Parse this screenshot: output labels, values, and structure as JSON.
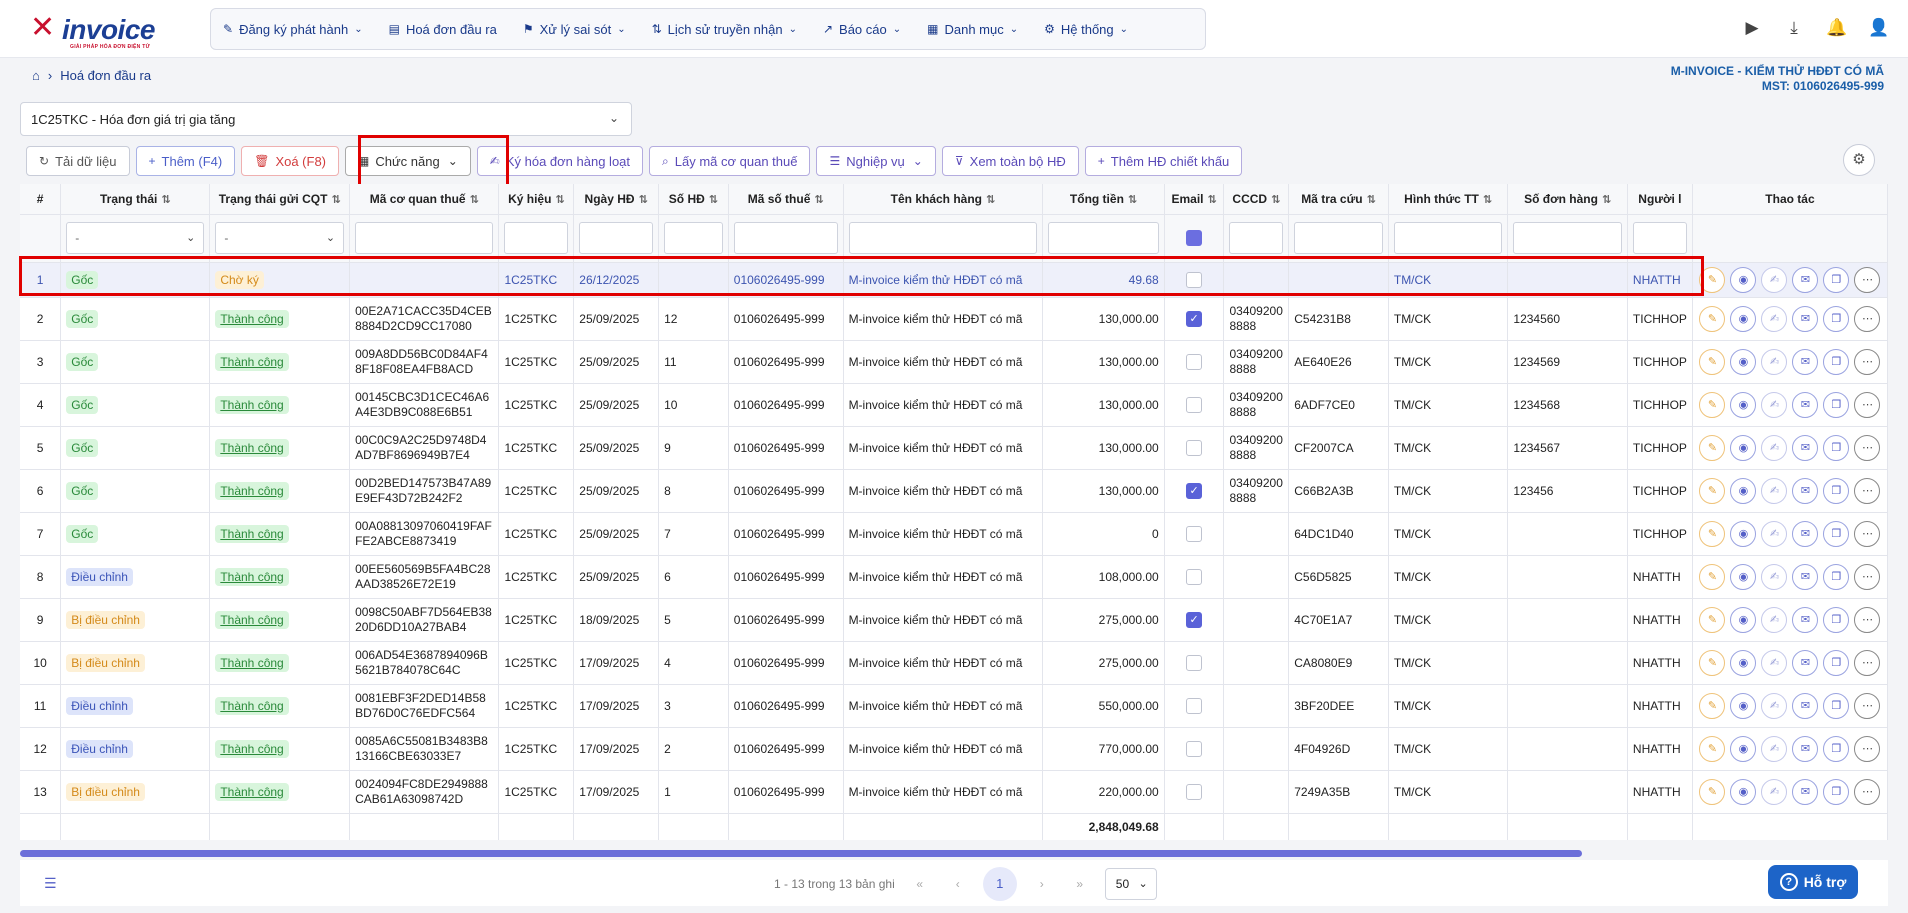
{
  "app": {
    "logo_text": "invoice",
    "logo_tagline": "GIẢI PHÁP HÓA ĐƠN ĐIỆN TỬ"
  },
  "menu": [
    {
      "label": "Đăng ký phát hành",
      "icon": "register-icon",
      "chevron": true
    },
    {
      "label": "Hoá đơn đầu ra",
      "icon": "document-icon",
      "chevron": false
    },
    {
      "label": "Xử lý sai sót",
      "icon": "error-file-icon",
      "chevron": true
    },
    {
      "label": "Lịch sử truyền nhận",
      "icon": "transfer-icon",
      "chevron": true
    },
    {
      "label": "Báo cáo",
      "icon": "report-chart-icon",
      "chevron": true
    },
    {
      "label": "Danh mục",
      "icon": "grid-icon",
      "chevron": true
    },
    {
      "label": "Hệ thống",
      "icon": "gear-icon",
      "chevron": true
    }
  ],
  "breadcrumb": {
    "current": "Hoá đơn đầu ra"
  },
  "company": {
    "name": "M-INVOICE - KIỂM THỬ HĐĐT CÓ MÃ",
    "tax_code": "MST: 0106026495-999"
  },
  "doc_type_select": {
    "value": "1C25TKC - Hóa đơn giá trị gia tăng"
  },
  "toolbar": {
    "reload": "Tải dữ liệu",
    "add": "Thêm (F4)",
    "delete": "Xoá (F8)",
    "functions": "Chức năng",
    "bulk_sign": "Ký hóa đơn hàng loạt",
    "get_tax_code": "Lấy mã cơ quan thuế",
    "operations": "Nghiệp vụ",
    "view_all": "Xem toàn bộ HĐ",
    "add_discount": "Thêm HĐ chiết khấu"
  },
  "columns": [
    "#",
    "Trạng thái",
    "Trạng thái gửi CQT",
    "Mã cơ quan thuế",
    "Ký hiệu",
    "Ngày HĐ",
    "Số HĐ",
    "Mã số thuế",
    "Tên khách hàng",
    "Tổng tiền",
    "Email",
    "CCCD",
    "Mã tra cứu",
    "Hình thức TT",
    "Số đơn hàng",
    "Người l",
    "Thao tác"
  ],
  "filters": {
    "status": "-",
    "cqt_status": "-"
  },
  "rows": [
    {
      "no": "1",
      "status": "Gốc",
      "status_type": "goc",
      "cqt": "Chờ ký",
      "cqt_type": "ck",
      "tax_auth_code": "",
      "symbol": "1C25TKC",
      "date": "26/12/2025",
      "inv_no": "",
      "tax_id": "0106026495-999",
      "customer": "M-invoice kiểm thử HĐĐT có mã",
      "total": "49.68",
      "email": false,
      "cccd": "",
      "lookup": "",
      "payment": "TM/CK",
      "order_no": "",
      "creator": "NHATTH"
    },
    {
      "no": "2",
      "status": "Gốc",
      "status_type": "goc",
      "cqt": "Thành công",
      "cqt_type": "tc",
      "tax_auth_code": "00E2A71CACC35D4CEB8884D2CD9CC17080",
      "symbol": "1C25TKC",
      "date": "25/09/2025",
      "inv_no": "12",
      "tax_id": "0106026495-999",
      "customer": "M-invoice kiểm thử HĐĐT có mã",
      "total": "130,000.00",
      "email": true,
      "cccd": "034092008888",
      "lookup": "C54231B8",
      "payment": "TM/CK",
      "order_no": "1234560",
      "creator": "TICHHOP"
    },
    {
      "no": "3",
      "status": "Gốc",
      "status_type": "goc",
      "cqt": "Thành công",
      "cqt_type": "tc",
      "tax_auth_code": "009A8DD56BC0D84AF48F18F08EA4FB8ACD",
      "symbol": "1C25TKC",
      "date": "25/09/2025",
      "inv_no": "11",
      "tax_id": "0106026495-999",
      "customer": "M-invoice kiểm thử HĐĐT có mã",
      "total": "130,000.00",
      "email": false,
      "cccd": "034092008888",
      "lookup": "AE640E26",
      "payment": "TM/CK",
      "order_no": "1234569",
      "creator": "TICHHOP"
    },
    {
      "no": "4",
      "status": "Gốc",
      "status_type": "goc",
      "cqt": "Thành công",
      "cqt_type": "tc",
      "tax_auth_code": "00145CBC3D1CEC46A6A4E3DB9C088E6B51",
      "symbol": "1C25TKC",
      "date": "25/09/2025",
      "inv_no": "10",
      "tax_id": "0106026495-999",
      "customer": "M-invoice kiểm thử HĐĐT có mã",
      "total": "130,000.00",
      "email": false,
      "cccd": "034092008888",
      "lookup": "6ADF7CE0",
      "payment": "TM/CK",
      "order_no": "1234568",
      "creator": "TICHHOP"
    },
    {
      "no": "5",
      "status": "Gốc",
      "status_type": "goc",
      "cqt": "Thành công",
      "cqt_type": "tc",
      "tax_auth_code": "00C0C9A2C25D9748D4AD7BF8696949B7E4",
      "symbol": "1C25TKC",
      "date": "25/09/2025",
      "inv_no": "9",
      "tax_id": "0106026495-999",
      "customer": "M-invoice kiểm thử HĐĐT có mã",
      "total": "130,000.00",
      "email": false,
      "cccd": "034092008888",
      "lookup": "CF2007CA",
      "payment": "TM/CK",
      "order_no": "1234567",
      "creator": "TICHHOP"
    },
    {
      "no": "6",
      "status": "Gốc",
      "status_type": "goc",
      "cqt": "Thành công",
      "cqt_type": "tc",
      "tax_auth_code": "00D2BED147573B47A89E9EF43D72B242F2",
      "symbol": "1C25TKC",
      "date": "25/09/2025",
      "inv_no": "8",
      "tax_id": "0106026495-999",
      "customer": "M-invoice kiểm thử HĐĐT có mã",
      "total": "130,000.00",
      "email": true,
      "cccd": "034092008888",
      "lookup": "C66B2A3B",
      "payment": "TM/CK",
      "order_no": "123456",
      "creator": "TICHHOP"
    },
    {
      "no": "7",
      "status": "Gốc",
      "status_type": "goc",
      "cqt": "Thành công",
      "cqt_type": "tc",
      "tax_auth_code": "00A08813097060419FAFFE2ABCE8873419",
      "symbol": "1C25TKC",
      "date": "25/09/2025",
      "inv_no": "7",
      "tax_id": "0106026495-999",
      "customer": "M-invoice kiểm thử HĐĐT có mã",
      "total": "0",
      "email": false,
      "cccd": "",
      "lookup": "64DC1D40",
      "payment": "TM/CK",
      "order_no": "",
      "creator": "TICHHOP"
    },
    {
      "no": "8",
      "status": "Điều chỉnh",
      "status_type": "dc",
      "cqt": "Thành công",
      "cqt_type": "tc",
      "tax_auth_code": "00EE560569B5FA4BC28AAD38526E72E19",
      "symbol": "1C25TKC",
      "date": "25/09/2025",
      "inv_no": "6",
      "tax_id": "0106026495-999",
      "customer": "M-invoice kiểm thử HĐĐT có mã",
      "total": "108,000.00",
      "email": false,
      "cccd": "",
      "lookup": "C56D5825",
      "payment": "TM/CK",
      "order_no": "",
      "creator": "NHATTH"
    },
    {
      "no": "9",
      "status": "Bị điều chỉnh",
      "status_type": "bdc",
      "cqt": "Thành công",
      "cqt_type": "tc",
      "tax_auth_code": "0098C50ABF7D564EB3820D6DD10A27BAB4",
      "symbol": "1C25TKC",
      "date": "18/09/2025",
      "inv_no": "5",
      "tax_id": "0106026495-999",
      "customer": "M-invoice kiểm thử HĐĐT có mã",
      "total": "275,000.00",
      "email": true,
      "cccd": "",
      "lookup": "4C70E1A7",
      "payment": "TM/CK",
      "order_no": "",
      "creator": "NHATTH"
    },
    {
      "no": "10",
      "status": "Bị điều chỉnh",
      "status_type": "bdc",
      "cqt": "Thành công",
      "cqt_type": "tc",
      "tax_auth_code": "006AD54E3687894096B5621B784078C64C",
      "symbol": "1C25TKC",
      "date": "17/09/2025",
      "inv_no": "4",
      "tax_id": "0106026495-999",
      "customer": "M-invoice kiểm thử HĐĐT có mã",
      "total": "275,000.00",
      "email": false,
      "cccd": "",
      "lookup": "CA8080E9",
      "payment": "TM/CK",
      "order_no": "",
      "creator": "NHATTH"
    },
    {
      "no": "11",
      "status": "Điều chỉnh",
      "status_type": "dc",
      "cqt": "Thành công",
      "cqt_type": "tc",
      "tax_auth_code": "0081EBF3F2DED14B58BD76D0C76EDFC564",
      "symbol": "1C25TKC",
      "date": "17/09/2025",
      "inv_no": "3",
      "tax_id": "0106026495-999",
      "customer": "M-invoice kiểm thử HĐĐT có mã",
      "total": "550,000.00",
      "email": false,
      "cccd": "",
      "lookup": "3BF20DEE",
      "payment": "TM/CK",
      "order_no": "",
      "creator": "NHATTH"
    },
    {
      "no": "12",
      "status": "Điều chỉnh",
      "status_type": "dc",
      "cqt": "Thành công",
      "cqt_type": "tc",
      "tax_auth_code": "0085A6C55081B3483B813166CBE63033E7",
      "symbol": "1C25TKC",
      "date": "17/09/2025",
      "inv_no": "2",
      "tax_id": "0106026495-999",
      "customer": "M-invoice kiểm thử HĐĐT có mã",
      "total": "770,000.00",
      "email": false,
      "cccd": "",
      "lookup": "4F04926D",
      "payment": "TM/CK",
      "order_no": "",
      "creator": "NHATTH"
    },
    {
      "no": "13",
      "status": "Bị điều chỉnh",
      "status_type": "bdc",
      "cqt": "Thành công",
      "cqt_type": "tc",
      "tax_auth_code": "0024094FC8DE2949888CAB61A63098742D",
      "symbol": "1C25TKC",
      "date": "17/09/2025",
      "inv_no": "1",
      "tax_id": "0106026495-999",
      "customer": "M-invoice kiểm thử HĐĐT có mã",
      "total": "220,000.00",
      "email": false,
      "cccd": "",
      "lookup": "7249A35B",
      "payment": "TM/CK",
      "order_no": "",
      "creator": "NHATTH"
    }
  ],
  "grand_total": "2,848,049.68",
  "pagination": {
    "summary": "1 - 13 trong 13 bản ghi",
    "current_page": "1",
    "page_size": "50"
  },
  "support": {
    "label": "Hỗ trợ"
  },
  "colors": {
    "primary": "#4a5ec8",
    "highlight": "#e00000",
    "brand_red": "#c8102e",
    "brand_blue": "#1c3f94"
  }
}
